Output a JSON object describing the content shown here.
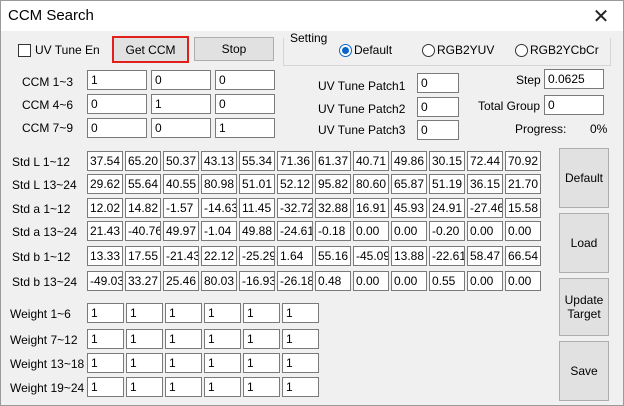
{
  "window": {
    "title": "CCM Search"
  },
  "controls": {
    "uv_tune_en_label": "UV Tune En",
    "get_ccm_label": "Get CCM",
    "stop_label": "Stop"
  },
  "setting": {
    "label": "Setting",
    "options": [
      "Default",
      "RGB2YUV",
      "RGB2YCbCr"
    ],
    "selected": "Default"
  },
  "ccm": {
    "rows": [
      {
        "label": "CCM 1~3",
        "values": [
          "1",
          "0",
          "0"
        ]
      },
      {
        "label": "CCM 4~6",
        "values": [
          "0",
          "1",
          "0"
        ]
      },
      {
        "label": "CCM 7~9",
        "values": [
          "0",
          "0",
          "1"
        ]
      }
    ]
  },
  "uv_tune": {
    "patches": [
      {
        "label": "UV Tune Patch1",
        "value": "0"
      },
      {
        "label": "UV Tune Patch2",
        "value": "0"
      },
      {
        "label": "UV Tune Patch3",
        "value": "0"
      }
    ]
  },
  "step": {
    "label": "Step",
    "value": "0.0625"
  },
  "total_group": {
    "label": "Total Group",
    "value": "0"
  },
  "progress": {
    "label": "Progress:",
    "value": "0%"
  },
  "std": {
    "rows": [
      {
        "label": "Std L 1~12",
        "values": [
          "37.54",
          "65.20",
          "50.37",
          "43.13",
          "55.34",
          "71.36",
          "61.37",
          "40.71",
          "49.86",
          "30.15",
          "72.44",
          "70.92"
        ]
      },
      {
        "label": "Std L 13~24",
        "values": [
          "29.62",
          "55.64",
          "40.55",
          "80.98",
          "51.01",
          "52.12",
          "95.82",
          "80.60",
          "65.87",
          "51.19",
          "36.15",
          "21.70"
        ]
      },
      {
        "label": "Std a 1~12",
        "values": [
          "12.02",
          "14.82",
          "-1.57",
          "-14.63",
          "11.45",
          "-32.72",
          "32.88",
          "16.91",
          "45.93",
          "24.91",
          "-27.46",
          "15.58"
        ]
      },
      {
        "label": "Std a 13~24",
        "values": [
          "21.43",
          "-40.76",
          "49.97",
          "-1.04",
          "49.88",
          "-24.61",
          "-0.18",
          "0.00",
          "0.00",
          "-0.20",
          "0.00",
          "0.00"
        ]
      },
      {
        "label": "Std b 1~12",
        "values": [
          "13.33",
          "17.55",
          "-21.43",
          "22.12",
          "-25.29",
          "1.64",
          "55.16",
          "-45.09",
          "13.88",
          "-22.61",
          "58.47",
          "66.54"
        ]
      },
      {
        "label": "Std b 13~24",
        "values": [
          "-49.03",
          "33.27",
          "25.46",
          "80.03",
          "-16.93",
          "-26.18",
          "0.48",
          "0.00",
          "0.00",
          "0.55",
          "0.00",
          "0.00"
        ]
      }
    ]
  },
  "weights": {
    "rows": [
      {
        "label": "Weight 1~6",
        "values": [
          "1",
          "1",
          "1",
          "1",
          "1",
          "1"
        ]
      },
      {
        "label": "Weight 7~12",
        "values": [
          "1",
          "1",
          "1",
          "1",
          "1",
          "1"
        ]
      },
      {
        "label": "Weight 13~18",
        "values": [
          "1",
          "1",
          "1",
          "1",
          "1",
          "1"
        ]
      },
      {
        "label": "Weight 19~24",
        "values": [
          "1",
          "1",
          "1",
          "1",
          "1",
          "1"
        ]
      }
    ]
  },
  "side_buttons": {
    "default_label": "Default",
    "load_label": "Load",
    "update_target_label": "Update Target",
    "save_label": "Save"
  },
  "colors": {
    "highlight": "#e0201c",
    "radio_accent": "#0a64c8"
  }
}
